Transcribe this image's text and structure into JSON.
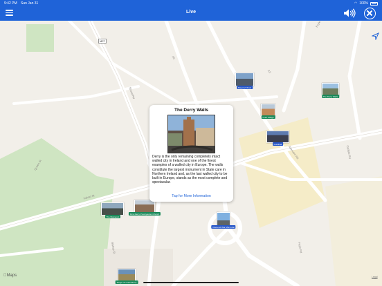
{
  "status_bar": {
    "time": "9:42 PM",
    "date": "Sun Jan 31",
    "battery": "100%"
  },
  "nav": {
    "title": "Live"
  },
  "map": {
    "road_labels": [
      "M27",
      "A5",
      "A2",
      "Foyle St",
      "Strand Rd",
      "Fahan St",
      "Bishop St",
      "Abercorn Rd",
      "Foyle Rd",
      "Carlisle Rd",
      "Queen St"
    ],
    "pins": [
      {
        "name": "Mayoral Chain",
        "label": "Mayoral Chain"
      },
      {
        "name": "The Derry Walls",
        "label": "The Derry Walls"
      },
      {
        "name": "Craft Village",
        "label": "Craft Village"
      },
      {
        "name": "Guildhall",
        "label": "Guildhall"
      },
      {
        "name": "The Diamond",
        "label": "The Diamond"
      },
      {
        "name": "First Derry Presbyterian Church",
        "label": "First Derry Presbyterian Church"
      },
      {
        "name": "Diamond War Memorial",
        "label": "Diamond War Memorial"
      },
      {
        "name": "Siege of Londonderry",
        "label": "Siege of Londonderry"
      }
    ],
    "maps_logo": "Maps",
    "legal": "Legal"
  },
  "callout": {
    "title": "The Derry Walls",
    "description": "Derry is the only remaining completely intact walled city in Ireland and one of the finest examples of a walled city in Europe. The walls constitute the largest monument in State care in Northern Ireland and, as the last walled city to be built in Europe, stands as the most complete and spectacular.",
    "link": "Tap for More Information"
  },
  "icons": [
    "menu-icon",
    "speaker-icon",
    "close-icon",
    "location-arrow-icon"
  ],
  "colors": {
    "nav_bar": "#1f63d8",
    "link": "#1f63d8",
    "tag_green": "#1a8a5a",
    "tag_blue": "#2757c9"
  }
}
